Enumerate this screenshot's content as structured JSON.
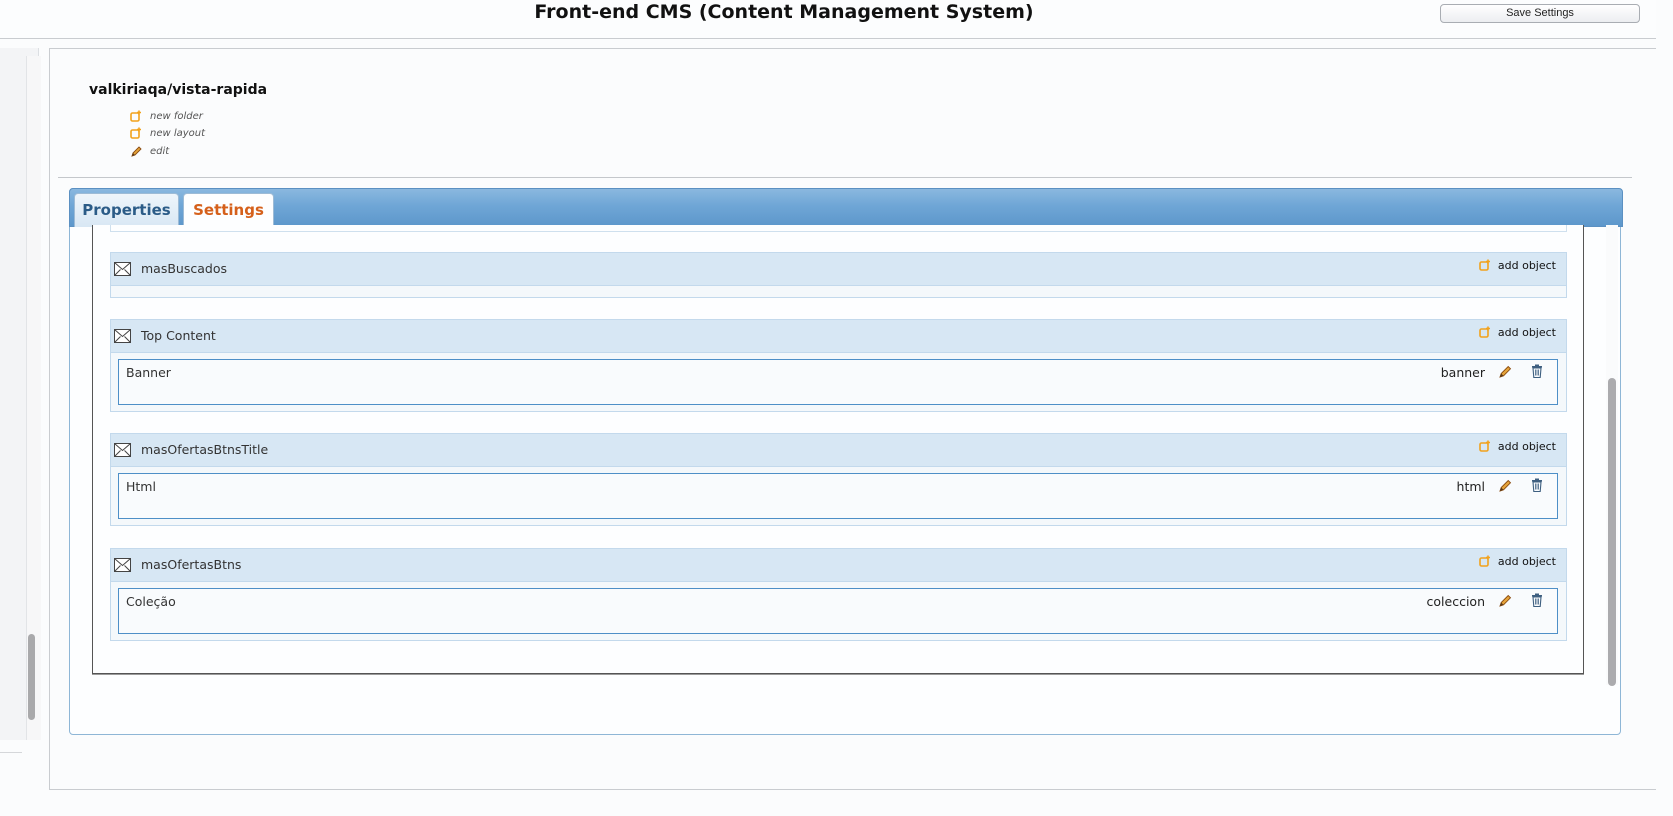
{
  "header": {
    "title": "Front-end CMS (Content Management System)",
    "save_label": "Save Settings"
  },
  "breadcrumb": {
    "path": "valkiriaqa/vista-rapida"
  },
  "actions": [
    {
      "label": "new folder",
      "icon": "add-folder-icon"
    },
    {
      "label": "new layout",
      "icon": "add-layout-icon"
    },
    {
      "label": "edit",
      "icon": "pencil-icon"
    }
  ],
  "tabs": [
    {
      "label": "Properties",
      "active": false
    },
    {
      "label": "Settings",
      "active": true
    }
  ],
  "sections": [
    {
      "title": "masBuscados",
      "add_label": "add object",
      "items": []
    },
    {
      "title": "Top Content",
      "add_label": "add object",
      "items": [
        {
          "name": "Banner",
          "type": "banner"
        }
      ]
    },
    {
      "title": "masOfertasBtnsTitle",
      "add_label": "add object",
      "items": [
        {
          "name": "Html",
          "type": "html"
        }
      ]
    },
    {
      "title": "masOfertasBtns",
      "add_label": "add object",
      "items": [
        {
          "name": "Coleção",
          "type": "coleccion"
        }
      ]
    }
  ],
  "colors": {
    "active_tab": "#d5601b",
    "inactive_tab": "#2b5b87",
    "tab_strip": "#6fa6d6",
    "section_header": "#d7e7f4",
    "item_border": "#4e8fc7",
    "icon_orange": "#f2a21c"
  }
}
